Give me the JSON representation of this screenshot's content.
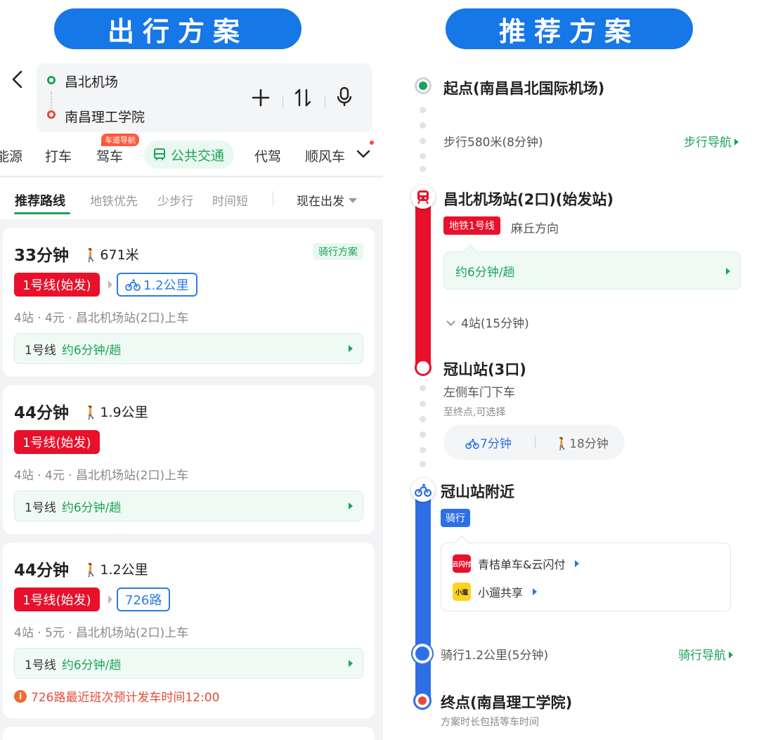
{
  "headers": {
    "left": "出行方案",
    "right": "推荐方案"
  },
  "search": {
    "origin": "昌北机场",
    "destination": "南昌理工学院"
  },
  "modes": {
    "items": [
      "能源",
      "打车",
      "驾车",
      "代驾",
      "顺风车"
    ],
    "active": "公共交通",
    "drive_badge": "车道导航"
  },
  "filters": {
    "items": [
      "推荐路线",
      "地铁优先",
      "少步行",
      "时间短"
    ],
    "depart": "现在出发"
  },
  "routes": [
    {
      "time": "33分钟",
      "walk": "671米",
      "tag": "骑行方案",
      "line": "1号线(始发)",
      "second_chip": "1.2公里",
      "stations": "4站 · 4元 · 昌北机场站(2口)上车",
      "freq_line": "1号线",
      "freq_text": "约6分钟/趟"
    },
    {
      "time": "44分钟",
      "walk": "1.9公里",
      "line": "1号线(始发)",
      "stations": "4站 · 4元 · 昌北机场站(2口)上车",
      "freq_line": "1号线",
      "freq_text": "约6分钟/趟"
    },
    {
      "time": "44分钟",
      "walk": "1.2公里",
      "line": "1号线(始发)",
      "second_chip": "726路",
      "stations": "4站 · 5元 · 昌北机场站(2口)上车",
      "freq_line": "1号线",
      "freq_text": "约6分钟/趟",
      "warning": "726路最近班次预计发车时间12:00"
    }
  ],
  "detail": {
    "start": "起点(南昌昌北国际机场)",
    "walk1": "步行580米(8分钟)",
    "walk_nav": "步行导航",
    "board_station": "昌北机场站(2口)(始发站)",
    "metro_line": "地铁1号线",
    "direction": "麻丘方向",
    "freq": "约6分钟/趟",
    "stops": "4站(15分钟)",
    "alight_station": "冠山站(3口)",
    "door": "左侧车门下车",
    "to_end": "至终点,可选择",
    "opt_bike": "7分钟",
    "opt_walk": "18分钟",
    "near": "冠山站附近",
    "ride": "骑行",
    "provider1": "青桔单车&云闪付",
    "provider1_logo": "云闪付",
    "provider2": "小遛共享",
    "provider2_logo": "小遛",
    "ride_dist": "骑行1.2公里(5分钟)",
    "ride_nav": "骑行导航",
    "end": "终点(南昌理工学院)",
    "note": "方案时长包括等车时间"
  },
  "colors": {
    "green": "#1aa35a",
    "red": "#e8102a",
    "blue": "#2f6fe6",
    "banner": "#1677e6"
  }
}
